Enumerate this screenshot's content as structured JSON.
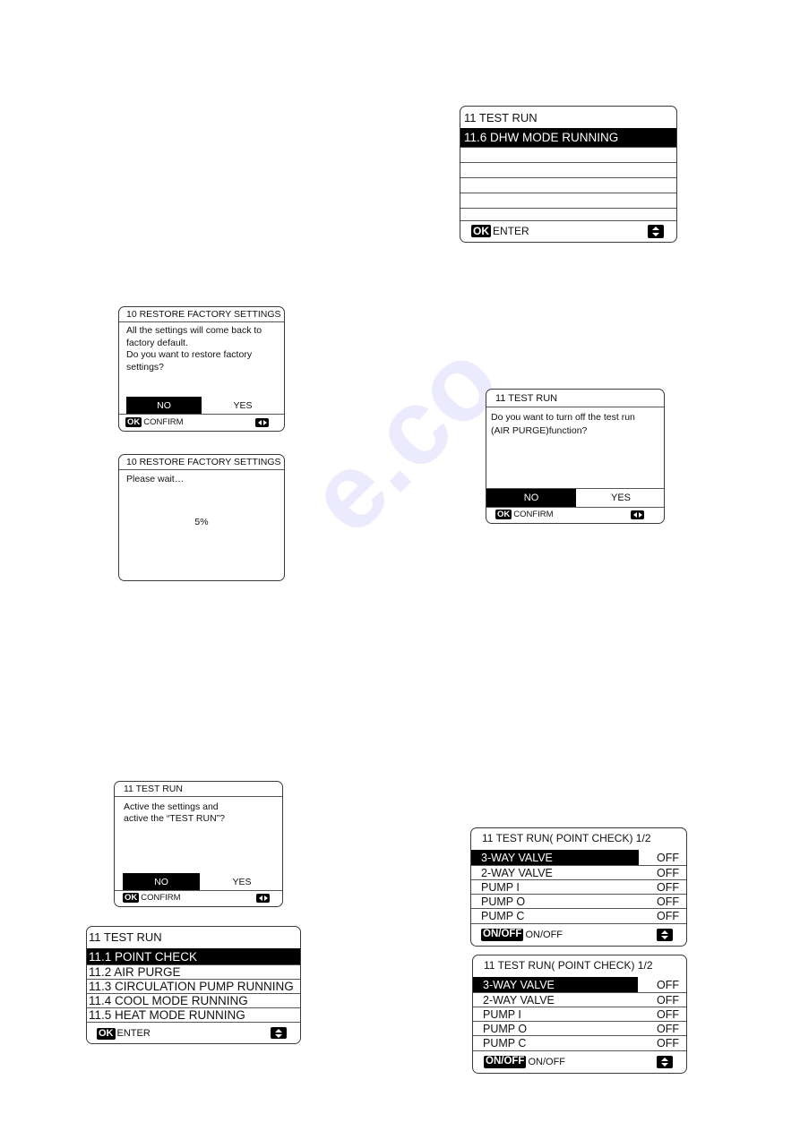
{
  "panels": {
    "dhw_menu": {
      "title": "11 TEST RUN",
      "selected_item": "11.6 DHW MODE RUNNING",
      "footer_badge": "OK",
      "footer_label": "ENTER",
      "nav_icon": "up-down-arrows-icon"
    },
    "restore_confirm": {
      "title": "10 RESTORE FACTORY SETTINGS",
      "message": "All the settings will come back to\nfactory default.\nDo you want to restore factory\nsettings?",
      "choice_no": "NO",
      "choice_yes": "YES",
      "selected_choice": "NO",
      "footer_badge": "OK",
      "footer_label": "CONFIRM",
      "nav_icon": "left-right-arrows-icon"
    },
    "restore_progress": {
      "title": "10 RESTORE FACTORY SETTINGS",
      "message": "Please wait…",
      "progress": "5%"
    },
    "air_purge_off": {
      "title": "11 TEST RUN",
      "message": "Do you want to turn off the test run\n(AIR PURGE)function?",
      "choice_no": "NO",
      "choice_yes": "YES",
      "selected_choice": "NO",
      "footer_badge": "OK",
      "footer_label": "CONFIRM",
      "nav_icon": "left-right-arrows-icon"
    },
    "test_run_activate": {
      "title": "11 TEST RUN",
      "message": "Active the settings and\nactive the “TEST RUN”?",
      "choice_no": "NO",
      "choice_yes": "YES",
      "selected_choice": "NO",
      "footer_badge": "OK",
      "footer_label": "CONFIRM",
      "nav_icon": "left-right-arrows-icon"
    },
    "test_run_menu": {
      "title": "11 TEST RUN",
      "items": [
        "11.1 POINT CHECK",
        "11.2 AIR PURGE",
        "11.3 CIRCULATION PUMP RUNNING",
        "11.4 COOL MODE RUNNING",
        "11.5 HEAT MODE RUNNING"
      ],
      "selected_index": 0,
      "footer_badge": "OK",
      "footer_label": "ENTER",
      "nav_icon": "up-down-arrows-icon"
    },
    "point_check_a": {
      "title": "11 TEST RUN( POINT CHECK) 1/2",
      "rows": [
        {
          "label": "3-WAY VALVE",
          "value": "OFF"
        },
        {
          "label": "2-WAY VALVE",
          "value": "OFF"
        },
        {
          "label": "PUMP I",
          "value": "OFF"
        },
        {
          "label": "PUMP O",
          "value": "OFF"
        },
        {
          "label": "PUMP C",
          "value": "OFF"
        }
      ],
      "selected_index": 0,
      "footer_badge": "ON/OFF",
      "footer_label": "ON/OFF",
      "nav_icon": "up-down-arrows-icon"
    },
    "point_check_b": {
      "title": "11 TEST RUN( POINT CHECK) 1/2",
      "rows": [
        {
          "label": "3-WAY VALVE",
          "value": "OFF"
        },
        {
          "label": "2-WAY VALVE",
          "value": "OFF"
        },
        {
          "label": "PUMP I",
          "value": "OFF"
        },
        {
          "label": "PUMP O",
          "value": "OFF"
        },
        {
          "label": "PUMP C",
          "value": "OFF"
        }
      ],
      "selected_index": 0,
      "footer_badge": "ON/OFF",
      "footer_label": "ON/OFF",
      "nav_icon": "up-down-arrows-icon"
    }
  }
}
